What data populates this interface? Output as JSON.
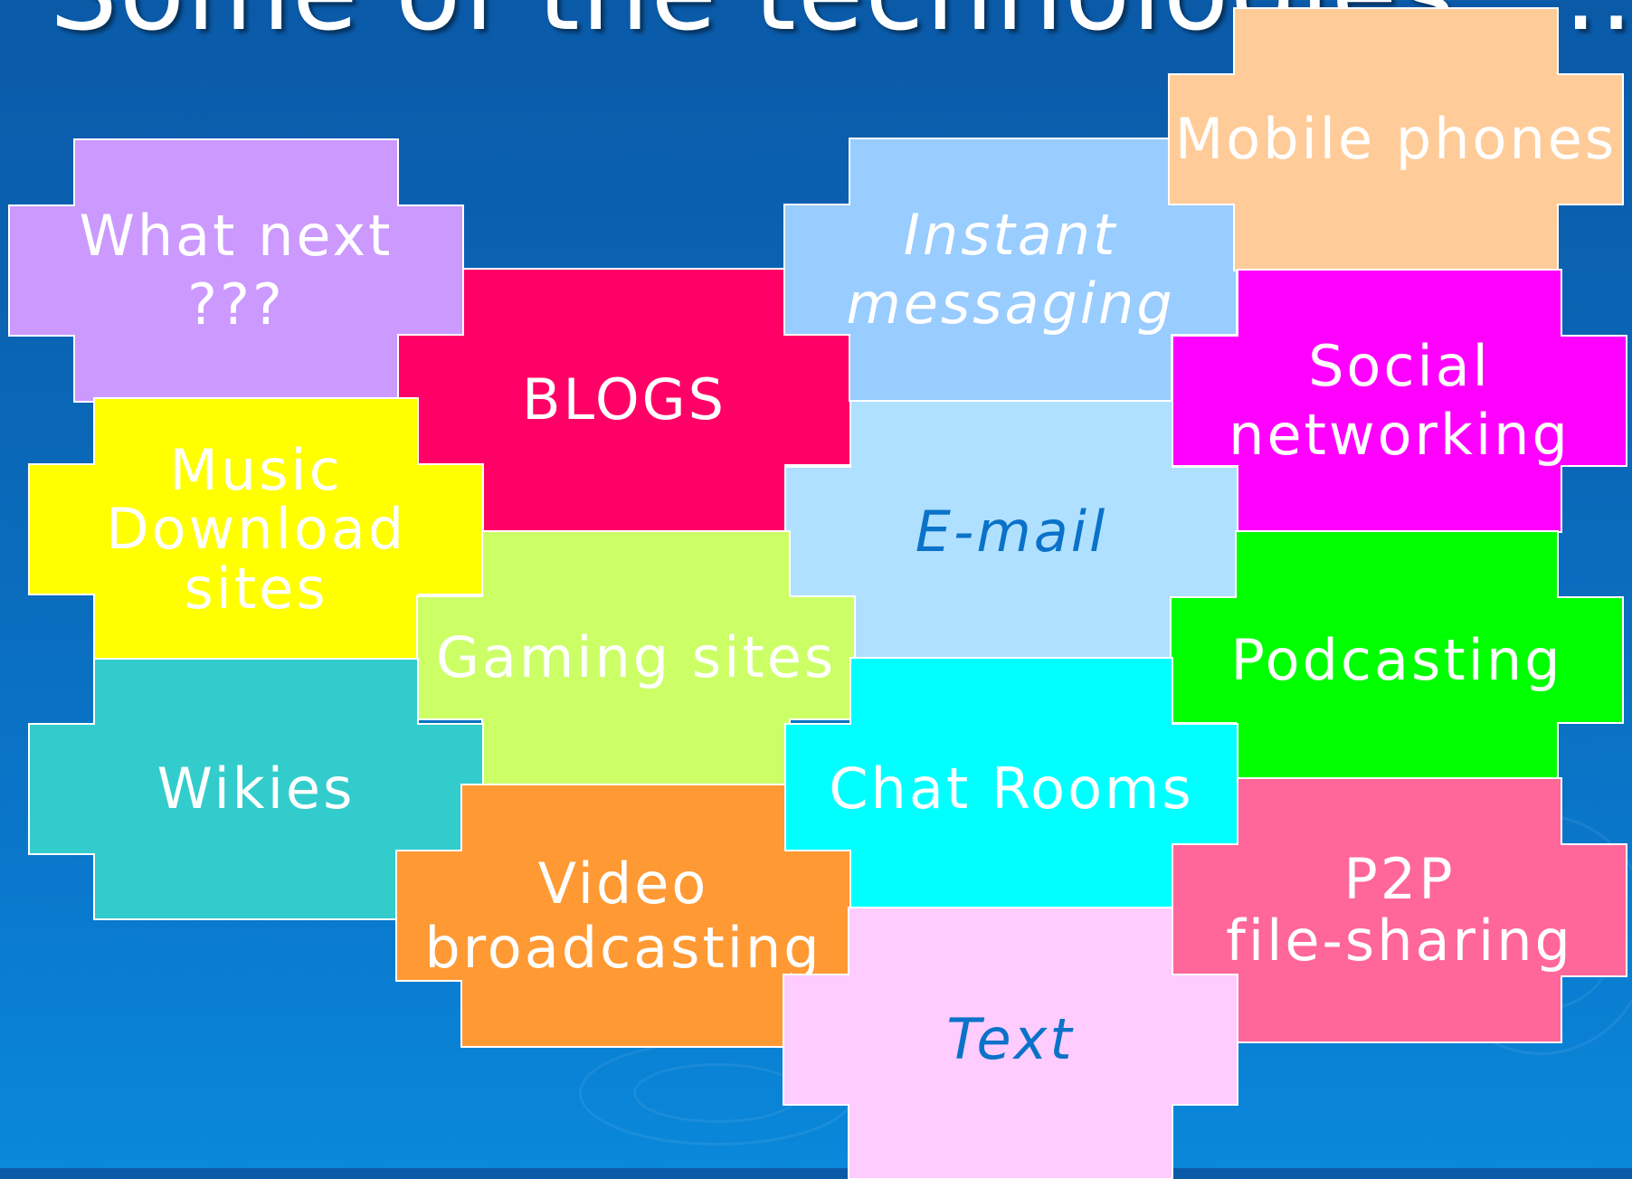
{
  "title": "Some of the technologies.....",
  "tiles": [
    {
      "id": "what-next",
      "label": "What next\n???",
      "color": "#cc99ff"
    },
    {
      "id": "blogs",
      "label": "BLOGS",
      "color": "#ff0066"
    },
    {
      "id": "instant-messaging",
      "label": "Instant\nmessaging",
      "color": "#99ccff"
    },
    {
      "id": "mobile-phones",
      "label": "Mobile phones",
      "color": "#ffcc99"
    },
    {
      "id": "music-download",
      "label": "Music\nDownload\nsites",
      "color": "#ffff00"
    },
    {
      "id": "email",
      "label": "E-mail",
      "color": "#b0e0ff"
    },
    {
      "id": "social-networking",
      "label": "Social\nnetworking",
      "color": "#ff00ff"
    },
    {
      "id": "gaming-sites",
      "label": "Gaming sites",
      "color": "#ccff66"
    },
    {
      "id": "podcasting",
      "label": "Podcasting",
      "color": "#00ff00"
    },
    {
      "id": "wikies",
      "label": "Wikies",
      "color": "#33cccc"
    },
    {
      "id": "chat-rooms",
      "label": "Chat Rooms",
      "color": "#00ffff"
    },
    {
      "id": "video-broadcasting",
      "label": "Video\nbroadcasting",
      "color": "#ff9933"
    },
    {
      "id": "p2p",
      "label": "P2P\nfile-sharing",
      "color": "#ff6699"
    },
    {
      "id": "text",
      "label": "Text",
      "color": "#ffccff"
    }
  ]
}
